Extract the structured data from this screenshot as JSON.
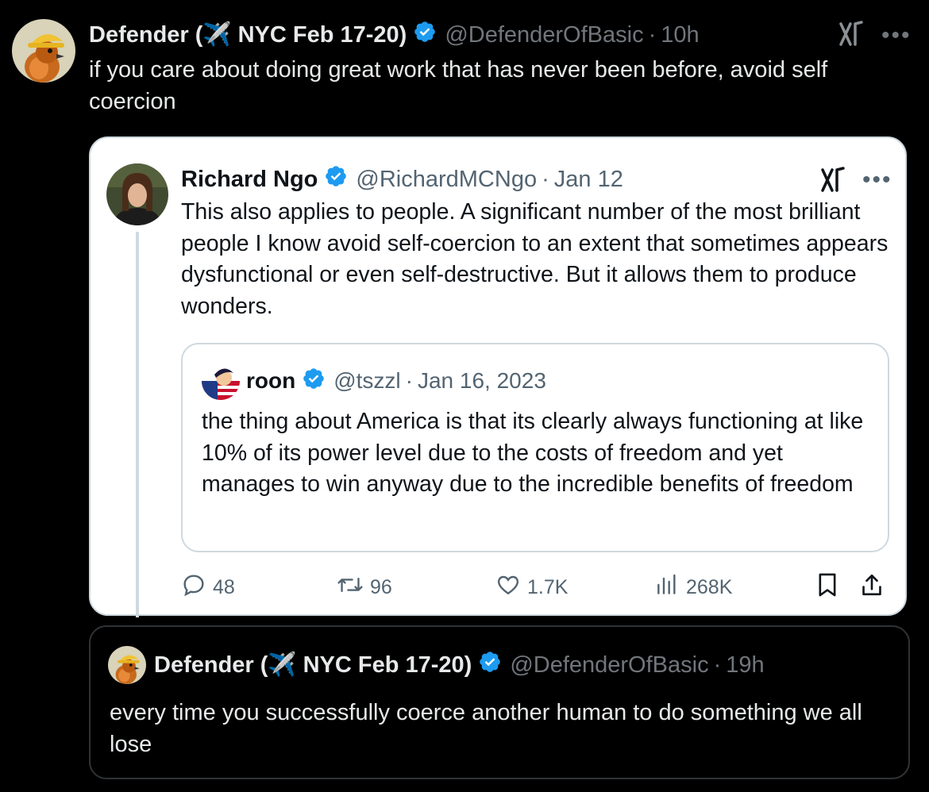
{
  "top_tweet": {
    "author_name": "Defender (✈️ NYC Feb 17-20)",
    "handle": "@DefenderOfBasic",
    "separator": "·",
    "time": "10h",
    "text": "if you care about doing great work that has never been before, avoid self coercion"
  },
  "quoted_tweet": {
    "author_name": "Richard Ngo",
    "handle": "@RichardMCNgo",
    "separator": "·",
    "time": "Jan 12",
    "text": "This also applies to people. A significant number of the most brilliant people I know avoid self-coercion to an extent that sometimes appears dysfunctional or even self-destructive. But it allows them to produce wonders.",
    "nested_quote": {
      "author_name": "roon",
      "handle": "@tszzl",
      "separator": "·",
      "time": "Jan 16, 2023",
      "text": "the thing about America is that its clearly always functioning at like 10% of its power level due to the costs of freedom and yet manages to win anyway due to the incredible benefits of freedom"
    },
    "actions": {
      "replies": "48",
      "reposts": "96",
      "likes": "1.7K",
      "views": "268K"
    }
  },
  "bottom_tweet": {
    "author_name": "Defender (✈️ NYC Feb 17-20)",
    "handle": "@DefenderOfBasic",
    "separator": "·",
    "time": "19h",
    "text": "every time you successfully coerce another human to do something we all lose"
  },
  "colors": {
    "background": "#000000",
    "verified_blue": "#1d9bf0",
    "muted_text": "#71767b"
  }
}
